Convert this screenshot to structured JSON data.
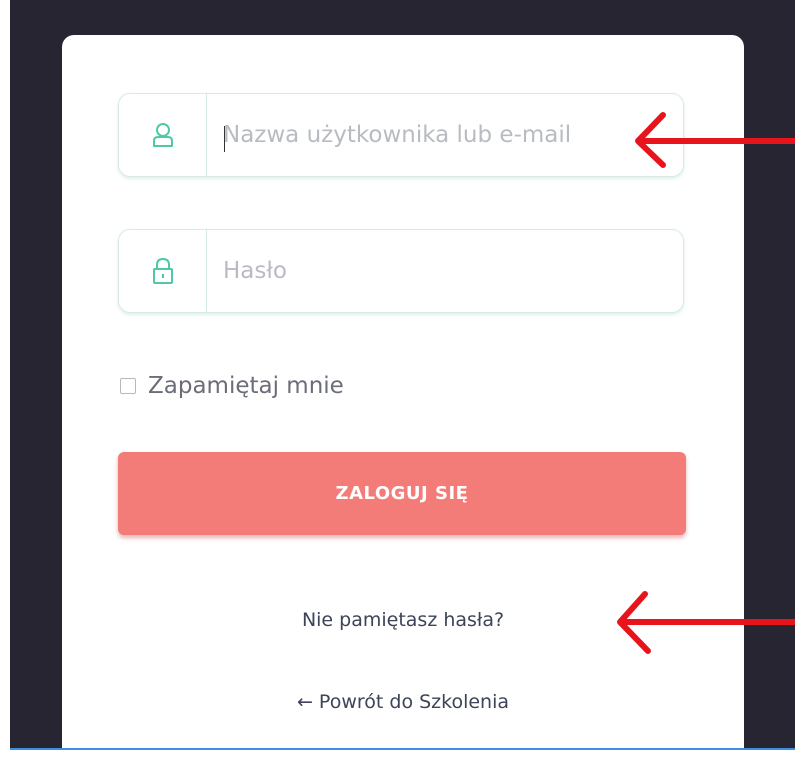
{
  "login_form": {
    "username": {
      "value": "",
      "placeholder": "Nazwa użytkownika lub e-mail",
      "icon": "user-icon"
    },
    "password": {
      "value": "",
      "placeholder": "Hasło",
      "icon": "lock-icon"
    },
    "remember_me": {
      "label": "Zapamiętaj mnie",
      "checked": false
    },
    "submit_label": "ZALOGUJ SIĘ",
    "forgot_password_label": "Nie pamiętasz hasła?",
    "back_link_label": "← Powrót do Szkolenia"
  },
  "annotations": {
    "arrow_color": "#e8141c"
  },
  "colors": {
    "background": "#272532",
    "card": "#ffffff",
    "button": "#f37b78",
    "field_border": "#d6ebe5",
    "icon": "#4ec9a6"
  }
}
